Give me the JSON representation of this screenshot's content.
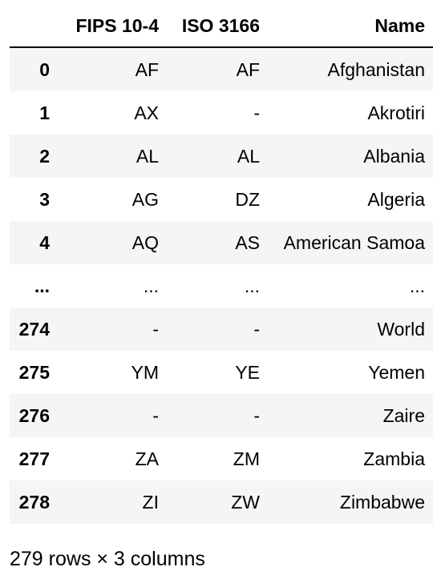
{
  "table": {
    "columns": [
      "",
      "FIPS 10-4",
      "ISO 3166",
      "Name"
    ],
    "rows": [
      {
        "index": "0",
        "fips": "AF",
        "iso": "AF",
        "name": "Afghanistan"
      },
      {
        "index": "1",
        "fips": "AX",
        "iso": "-",
        "name": "Akrotiri"
      },
      {
        "index": "2",
        "fips": "AL",
        "iso": "AL",
        "name": "Albania"
      },
      {
        "index": "3",
        "fips": "AG",
        "iso": "DZ",
        "name": "Algeria"
      },
      {
        "index": "4",
        "fips": "AQ",
        "iso": "AS",
        "name": "American Samoa"
      },
      {
        "index": "...",
        "fips": "...",
        "iso": "...",
        "name": "..."
      },
      {
        "index": "274",
        "fips": "-",
        "iso": "-",
        "name": "World"
      },
      {
        "index": "275",
        "fips": "YM",
        "iso": "YE",
        "name": "Yemen"
      },
      {
        "index": "276",
        "fips": "-",
        "iso": "-",
        "name": "Zaire"
      },
      {
        "index": "277",
        "fips": "ZA",
        "iso": "ZM",
        "name": "Zambia"
      },
      {
        "index": "278",
        "fips": "ZI",
        "iso": "ZW",
        "name": "Zimbabwe"
      }
    ]
  },
  "footer": {
    "shape_text": "279 rows × 3 columns"
  },
  "colors": {
    "stripe": "#f5f5f5",
    "background": "#ffffff",
    "text": "#000000"
  }
}
